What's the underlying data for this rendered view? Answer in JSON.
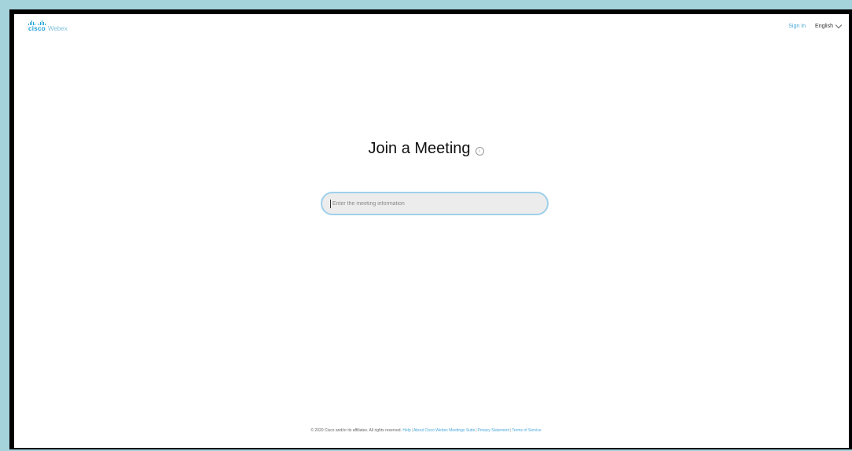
{
  "brand": {
    "company": "cisco",
    "product": "Webex",
    "color": "#1ba0d7"
  },
  "header": {
    "sign_in": "Sign In",
    "language": "English"
  },
  "main": {
    "title": "Join a Meeting",
    "info_icon": "info-icon",
    "input_placeholder": "Enter the meeting information"
  },
  "footer": {
    "copyright": "© 2020 Cisco and/or its affiliates. All rights reserved.",
    "links": [
      "Help",
      "About Cisco Webex Meetings Suite",
      "Privacy Statement",
      "Terms of Service"
    ]
  },
  "colors": {
    "accent": "#4aa8d8",
    "input_border": "#9fd0ea",
    "background_teal": "#a5d3dc"
  }
}
